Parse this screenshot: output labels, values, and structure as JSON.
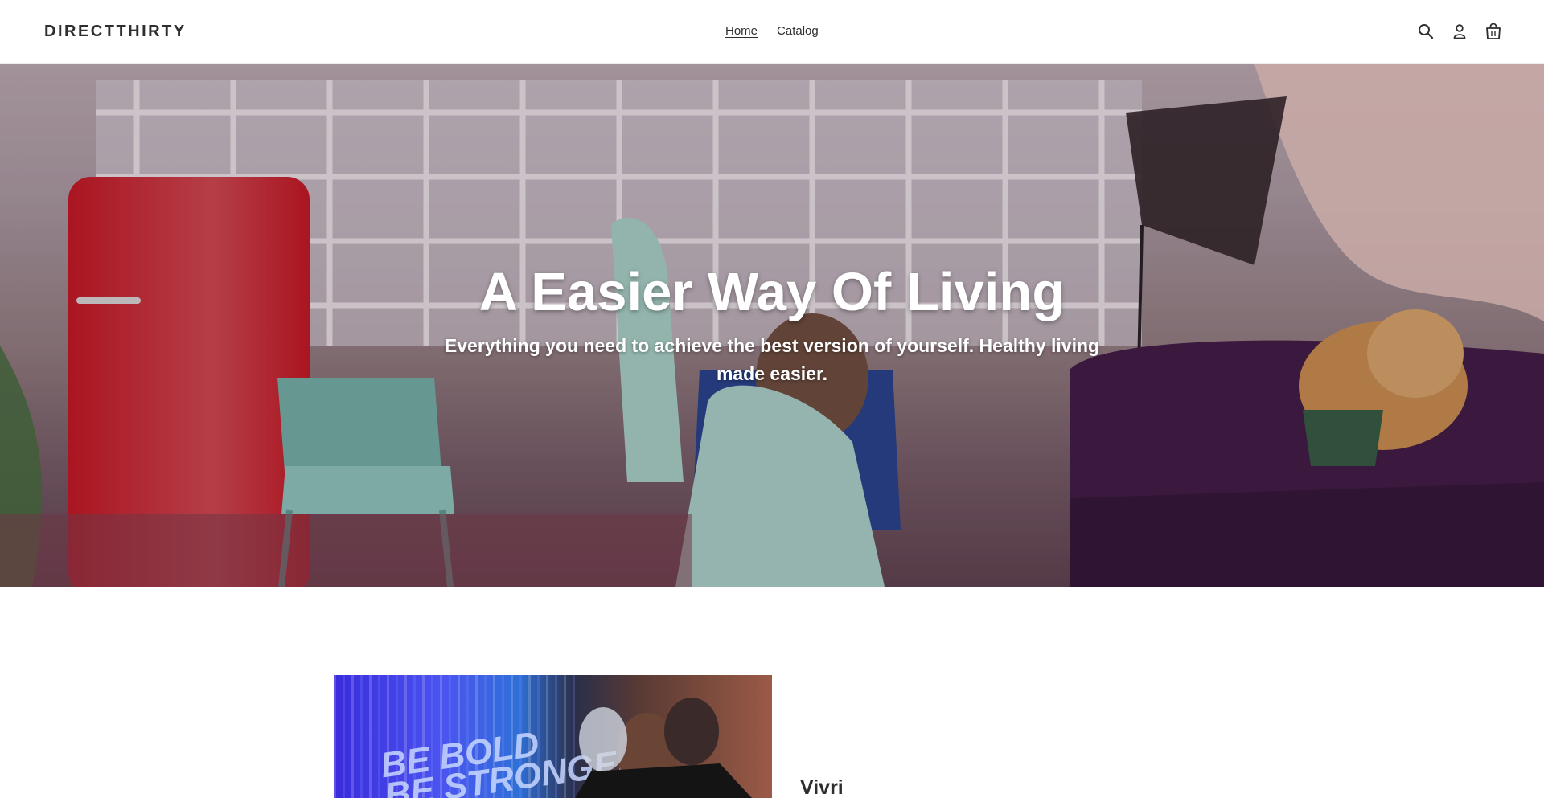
{
  "header": {
    "logo": "DIRECTTHIRTY",
    "nav": [
      {
        "label": "Home",
        "active": true
      },
      {
        "label": "Catalog",
        "active": false
      }
    ],
    "icons": [
      "search-icon",
      "account-icon",
      "cart-icon"
    ]
  },
  "hero": {
    "title": "A Easier Way Of Living",
    "subtitle": "Everything you need to achieve the best version of yourself. Healthy living made easier."
  },
  "feature": {
    "image_text": [
      "BE BOLD",
      "BE STRONGER"
    ],
    "title": "Vivri"
  },
  "colors": {
    "text": "#2e2e2e",
    "hero_text": "#ffffff"
  }
}
